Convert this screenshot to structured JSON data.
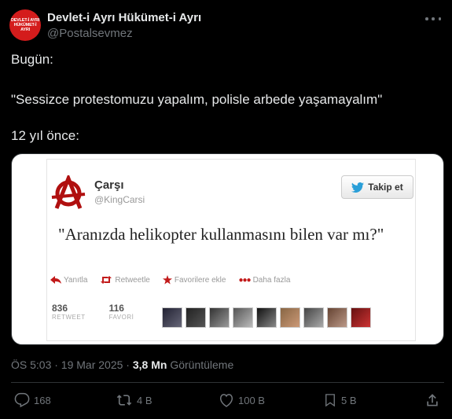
{
  "header": {
    "avatar_lines": [
      "DEVLET-İ AYRI",
      "HÜKÜMET-İ",
      "AYRI"
    ],
    "name": "Devlet-i Ayrı Hükümet-i Ayrı",
    "handle": "@Postalsevmez"
  },
  "tweet": {
    "line1": "Bugün:",
    "line2": "\"Sessizce protestomuzu yapalım, polisle arbede yaşamayalım\"",
    "line3": "12 yıl önce:"
  },
  "embed": {
    "name": "Çarşı",
    "handle": "@KingCarsi",
    "follow_label": "Takip et",
    "text": "\"Aranızda helikopter kullanmasını bilen var mı?\"",
    "actions": {
      "reply": "Yanıtla",
      "retweet": "Retweetle",
      "favorite": "Favorilere ekle",
      "more": "Daha fazla"
    },
    "retweet_count": "836",
    "retweet_label": "RETWEET",
    "favorite_count": "116",
    "favorite_label": "FAVORİ"
  },
  "meta": {
    "time": "ÖS 5:03 · 19 Mar 2025 ·",
    "views": "3,8 Mn",
    "views_label": "Görüntüleme"
  },
  "action_bar": {
    "replies": "168",
    "reposts": "4 B",
    "likes": "100 B",
    "bookmarks": "5 B"
  },
  "colors": {
    "accent": "#1d9bf0",
    "avatar_bg": "#d41c1c",
    "text": "#e7e9ea",
    "muted": "#71767b",
    "bg": "#000000"
  },
  "icons": [
    "more-icon",
    "anarchy-logo",
    "twitter-bird-icon",
    "reply-icon",
    "retweet-icon",
    "star-icon",
    "reply-count-icon",
    "repost-icon",
    "like-icon",
    "bookmark-icon",
    "share-icon"
  ]
}
